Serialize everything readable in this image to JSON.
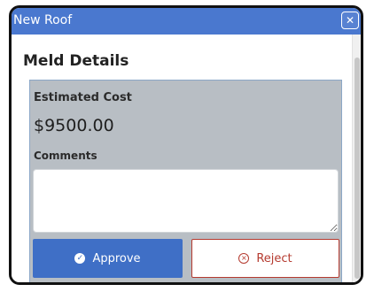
{
  "window": {
    "title": "New Roof",
    "close_symbol": "✕"
  },
  "details": {
    "heading": "Meld Details",
    "estimated_cost_label": "Estimated Cost",
    "estimated_cost_value": "$9500.00",
    "comments_label": "Comments",
    "comments_value": "",
    "comments_placeholder": ""
  },
  "actions": {
    "approve_label": "Approve",
    "reject_label": "Reject"
  },
  "icons": {
    "approve": "check-circle-icon",
    "reject": "x-circle-icon",
    "close": "close-icon"
  },
  "colors": {
    "header": "#4a78cf",
    "approve": "#3f6fc6",
    "reject": "#b53a2f",
    "panel": "#b8bec4"
  }
}
